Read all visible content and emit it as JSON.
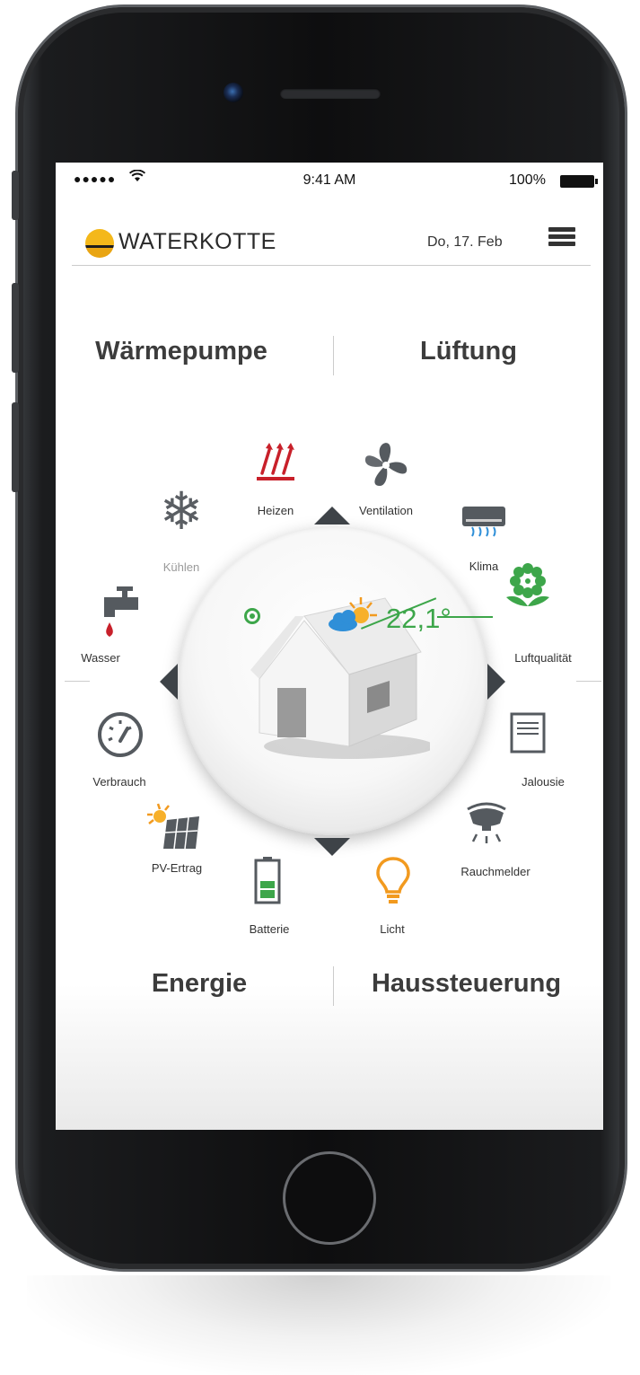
{
  "status_bar": {
    "carrier": "●●●●●",
    "time": "9:41 AM",
    "battery": "100%"
  },
  "header": {
    "logo": "WATERKOTTE",
    "date": "Do, 17. Feb"
  },
  "sections": {
    "top_left": "Wärmepumpe",
    "top_right": "Lüftung",
    "bottom_left": "Energie",
    "bottom_right": "Haussteuerung"
  },
  "hub": {
    "temperature": "22,1°"
  },
  "items": {
    "heizen": "Heizen",
    "ventilation": "Ventilation",
    "kuehlen": "Kühlen",
    "klima": "Klima",
    "wasser": "Wasser",
    "luftqualitaet": "Luftqualität",
    "verbrauch": "Verbrauch",
    "jalousie": "Jalousie",
    "pv_ertrag": "PV-Ertrag",
    "rauchmelder": "Rauchmelder",
    "batterie": "Batterie",
    "licht": "Licht"
  },
  "colors": {
    "accent_green": "#3da64a",
    "heat_red": "#c8202a",
    "light_orange": "#f29a1f",
    "logo_yellow": "#f4b81a"
  }
}
